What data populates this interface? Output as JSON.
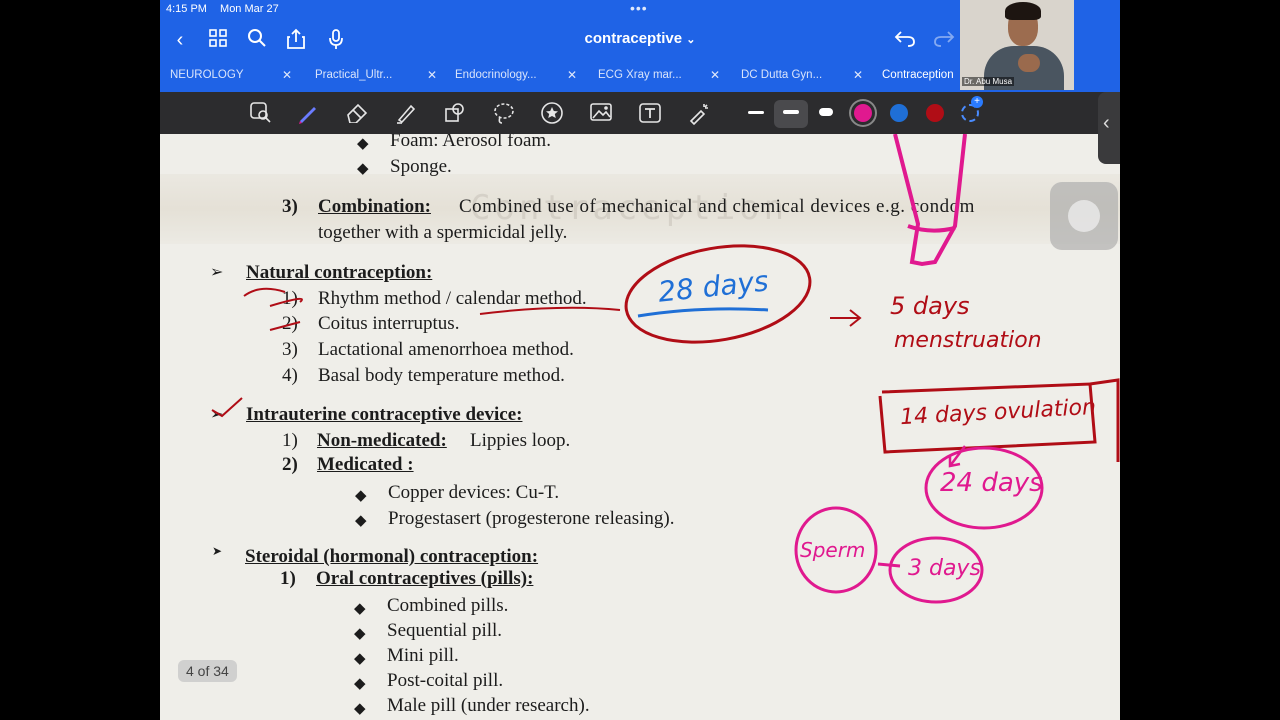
{
  "status_bar": {
    "time": "4:15 PM",
    "date": "Mon Mar 27"
  },
  "document": {
    "title": "contraceptive",
    "title_chevron": "⌄"
  },
  "tabs": [
    {
      "label": "NEUROLOGY"
    },
    {
      "label": "Practical_Ultr..."
    },
    {
      "label": "Endocrinology..."
    },
    {
      "label": "ECG Xray mar..."
    },
    {
      "label": "DC Dutta Gyn..."
    },
    {
      "label": "Contraception"
    }
  ],
  "toolbar": {
    "icons": [
      "lasso-zoom-icon",
      "pen-icon",
      "eraser-icon",
      "highlighter-icon",
      "shapes-icon",
      "lasso-icon",
      "sticker-icon",
      "image-icon",
      "text-icon",
      "laser-pointer-icon"
    ],
    "colors": {
      "magenta": "#e0198f",
      "blue": "#1f6fd6",
      "red": "#b00d16"
    }
  },
  "page": {
    "pager": "4 of 34",
    "watermark": "Contraception",
    "lines": {
      "foam": "Foam: Aerosol foam.",
      "sponge": "Sponge.",
      "combo_num": "3)",
      "combo_head": "Combination:",
      "combo_text": "Combined use of mechanical and chemical devices e.g. condom",
      "combo_text2": "together with a spermicidal jelly.",
      "natural_head": "Natural contraception:",
      "n1_num": "1)",
      "n1": "Rhythm method / calendar method.",
      "n2_num": "2)",
      "n2": "Coitus interruptus.",
      "n3_num": "3)",
      "n3": "Lactational amenorrhoea method.",
      "n4_num": "4)",
      "n4": "Basal body temperature method.",
      "iucd_head": "Intrauterine contraceptive device:",
      "i1_num": "1)",
      "i1_head": "Non-medicated:",
      "i1_text": "Lippies loop.",
      "i2_num": "2)",
      "i2_head": "Medicated :",
      "i2a": "Copper devices: Cu-T.",
      "i2b": "Progestasert (progesterone releasing).",
      "steroid_head": "Steroidal (hormonal) contraception:",
      "s1_num": "1)",
      "s1_head": "Oral contraceptives (pills):",
      "p1": "Combined pills.",
      "p2": "Sequential pill.",
      "p3": "Mini pill.",
      "p4": "Post-coital pill.",
      "p5": "Male pill (under research)."
    },
    "annotations": {
      "days28": "28 days",
      "days5": "5 days",
      "menstruation": "menstruation",
      "ovulation": "14 days ovulation",
      "days24": "24 days",
      "sperm": "Sperm",
      "sperm_days": "3 days"
    }
  },
  "video": {
    "presenter": "Dr. Abu Musa"
  }
}
